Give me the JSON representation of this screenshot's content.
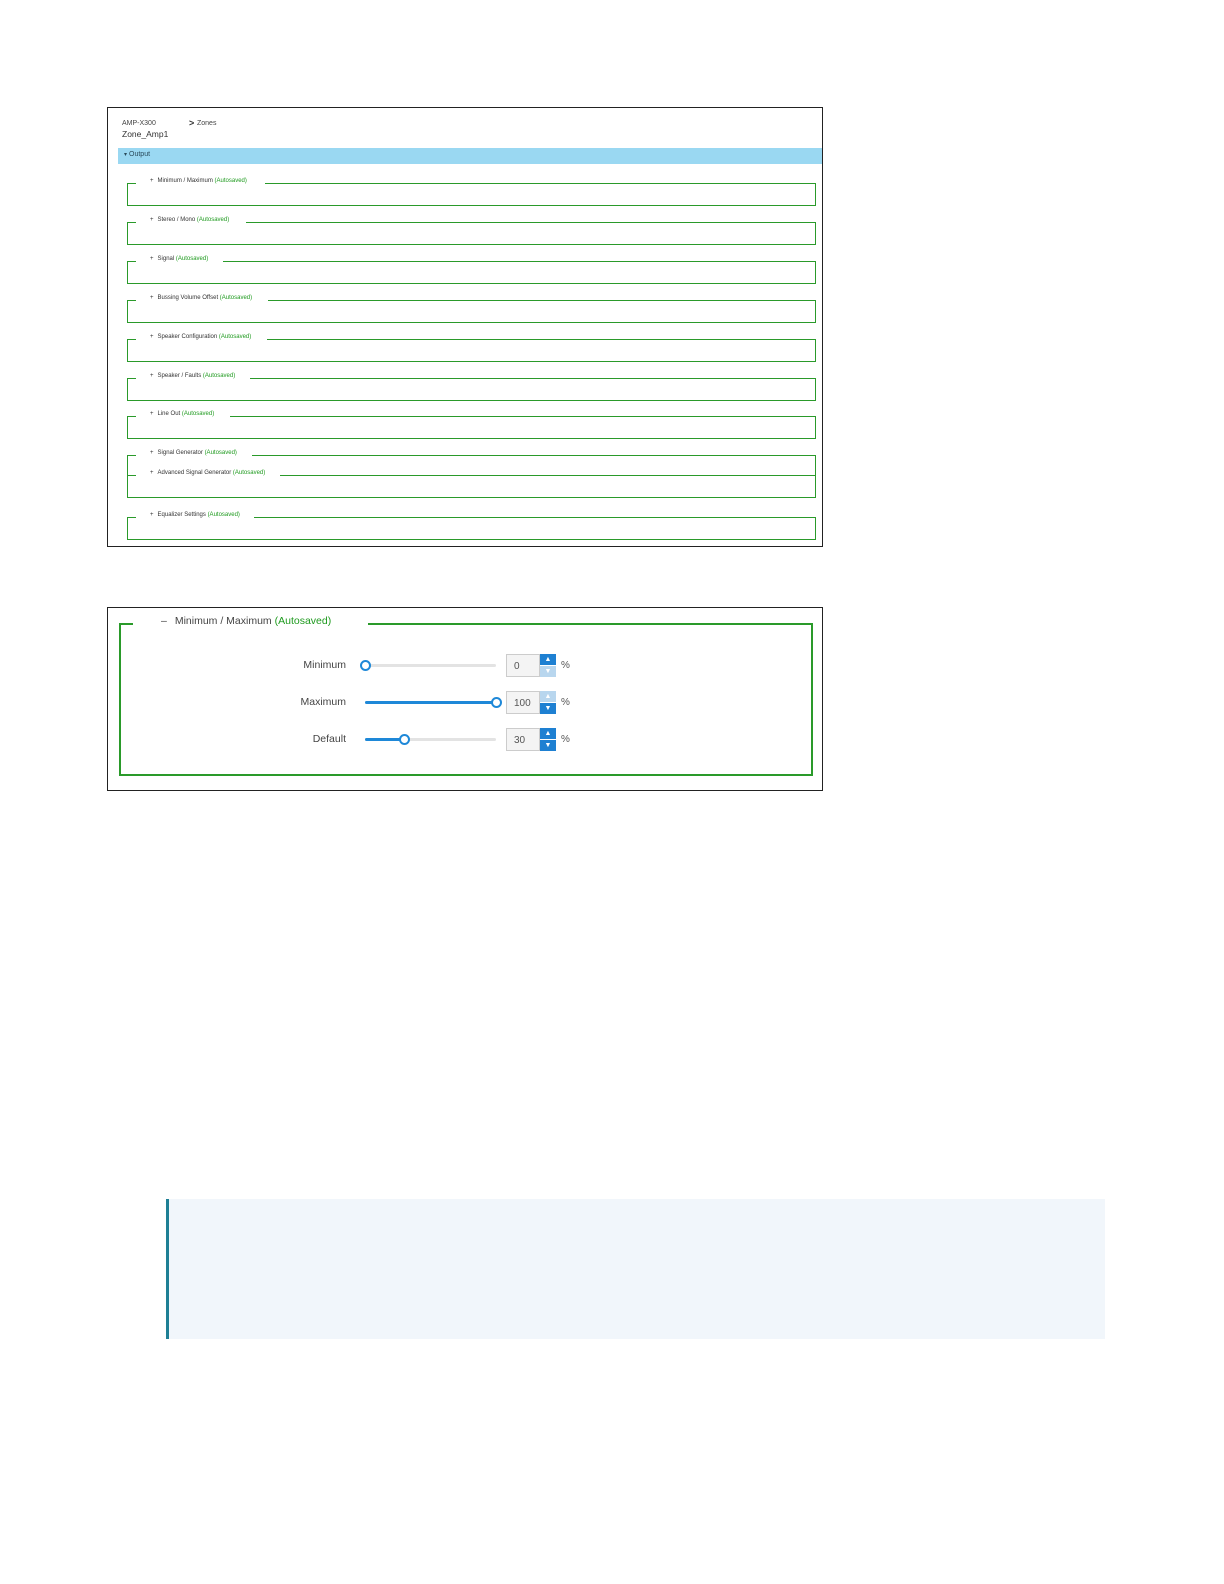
{
  "screenshot1": {
    "breadcrumb": {
      "device": "AMP-X300",
      "separator": ">",
      "section": "Zones"
    },
    "zone_name": "Zone_Amp1",
    "output_bar": {
      "caret": "▾",
      "label": "Output"
    },
    "autosaved_label": "(Autosaved)",
    "sections": [
      {
        "expander": "+",
        "title": "Minimum / Maximum"
      },
      {
        "expander": "+",
        "title": "Stereo / Mono"
      },
      {
        "expander": "+",
        "title": "Signal"
      },
      {
        "expander": "+",
        "title": "Bussing Volume Offset"
      },
      {
        "expander": "+",
        "title": "Speaker Configuration"
      },
      {
        "expander": "+",
        "title": "Speaker / Faults"
      },
      {
        "expander": "+",
        "title": "Line Out"
      },
      {
        "expander": "+",
        "title": "Signal Generator"
      },
      {
        "expander": "+",
        "title": "Advanced Signal Generator"
      },
      {
        "expander": "+",
        "title": "Equalizer Settings"
      }
    ]
  },
  "screenshot2": {
    "legend": {
      "expander": "–",
      "title": "Minimum / Maximum",
      "autosaved": "(Autosaved)"
    },
    "rows": [
      {
        "label": "Minimum",
        "value": "0",
        "unit": "%",
        "fraction": 0.0,
        "up_enabled": true,
        "down_enabled": false
      },
      {
        "label": "Maximum",
        "value": "100",
        "unit": "%",
        "fraction": 1.0,
        "up_enabled": false,
        "down_enabled": true
      },
      {
        "label": "Default",
        "value": "30",
        "unit": "%",
        "fraction": 0.3,
        "up_enabled": true,
        "down_enabled": true
      }
    ]
  },
  "colors": {
    "accent_green": "#2a9a2a",
    "autosaved_green": "#1e9a1e",
    "output_bar": "#9ad8f2",
    "slider_blue": "#1e88d8",
    "note_bg": "#f1f6fb",
    "note_border": "#1e7f95"
  }
}
